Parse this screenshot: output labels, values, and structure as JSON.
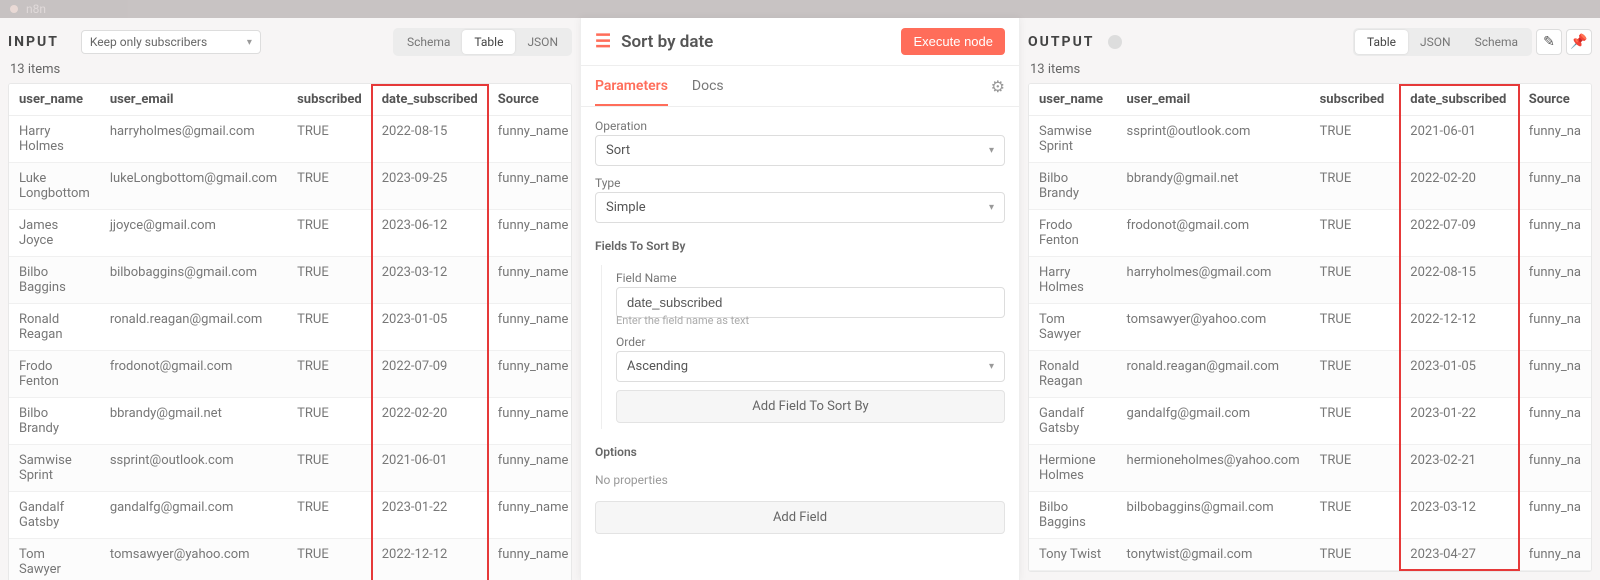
{
  "topbar": {
    "title": "n8n"
  },
  "input": {
    "title": "INPUT",
    "selector_value": "Keep only subscribers",
    "view_options": [
      "Schema",
      "Table",
      "JSON"
    ],
    "active_view": "Table",
    "count_label": "13 items",
    "columns": [
      "user_name",
      "user_email",
      "subscribed",
      "date_subscribed",
      "Source"
    ],
    "highlight_column": 3,
    "rows": [
      [
        "Harry Holmes",
        "harryholmes@gmail.com",
        "TRUE",
        "2022-08-15",
        "funny_name"
      ],
      [
        "Luke Longbottom",
        "lukeLongbottom@gmail.com",
        "TRUE",
        "2023-09-25",
        "funny_name"
      ],
      [
        "James Joyce",
        "jjoyce@gmail.com",
        "TRUE",
        "2023-06-12",
        "funny_name"
      ],
      [
        "Bilbo Baggins",
        "bilbobaggins@gmail.com",
        "TRUE",
        "2023-03-12",
        "funny_name"
      ],
      [
        "Ronald Reagan",
        "ronald.reagan@gmail.com",
        "TRUE",
        "2023-01-05",
        "funny_name"
      ],
      [
        "Frodo Fenton",
        "frodonot@gmail.com",
        "TRUE",
        "2022-07-09",
        "funny_name"
      ],
      [
        "Bilbo Brandy",
        "bbrandy@gmail.net",
        "TRUE",
        "2022-02-20",
        "funny_name"
      ],
      [
        "Samwise Sprint",
        "ssprint@outlook.com",
        "TRUE",
        "2021-06-01",
        "funny_name"
      ],
      [
        "Gandalf Gatsby",
        "gandalfg@gmail.com",
        "TRUE",
        "2023-01-22",
        "funny_name"
      ],
      [
        "Tom Sawyer",
        "tomsawyer@yahoo.com",
        "TRUE",
        "2022-12-12",
        "funny_name"
      ]
    ]
  },
  "node": {
    "title": "Sort by date",
    "execute_label": "Execute node",
    "tabs": [
      "Parameters",
      "Docs"
    ],
    "active_tab": "Parameters",
    "operation_label": "Operation",
    "operation_value": "Sort",
    "type_label": "Type",
    "type_value": "Simple",
    "fields_to_sort_label": "Fields To Sort By",
    "field_name_label": "Field Name",
    "field_name_value": "date_subscribed",
    "field_name_hint": "Enter the field name as text",
    "order_label": "Order",
    "order_value": "Ascending",
    "add_field_btn": "Add Field To Sort By",
    "options_label": "Options",
    "options_sub": "No properties",
    "add_field_btn2": "Add Field"
  },
  "output": {
    "title": "OUTPUT",
    "view_options": [
      "Table",
      "JSON",
      "Schema"
    ],
    "active_view": "Table",
    "count_label": "13 items",
    "columns": [
      "user_name",
      "user_email",
      "subscribed",
      "date_subscribed",
      "Source"
    ],
    "highlight_column": 3,
    "rows": [
      [
        "Samwise Sprint",
        "ssprint@outlook.com",
        "TRUE",
        "2021-06-01",
        "funny_na"
      ],
      [
        "Bilbo Brandy",
        "bbrandy@gmail.net",
        "TRUE",
        "2022-02-20",
        "funny_na"
      ],
      [
        "Frodo Fenton",
        "frodonot@gmail.com",
        "TRUE",
        "2022-07-09",
        "funny_na"
      ],
      [
        "Harry Holmes",
        "harryholmes@gmail.com",
        "TRUE",
        "2022-08-15",
        "funny_na"
      ],
      [
        "Tom Sawyer",
        "tomsawyer@yahoo.com",
        "TRUE",
        "2022-12-12",
        "funny_na"
      ],
      [
        "Ronald Reagan",
        "ronald.reagan@gmail.com",
        "TRUE",
        "2023-01-05",
        "funny_na"
      ],
      [
        "Gandalf Gatsby",
        "gandalfg@gmail.com",
        "TRUE",
        "2023-01-22",
        "funny_na"
      ],
      [
        "Hermione Holmes",
        "hermioneholmes@yahoo.com",
        "TRUE",
        "2023-02-21",
        "funny_na"
      ],
      [
        "Bilbo Baggins",
        "bilbobaggins@gmail.com",
        "TRUE",
        "2023-03-12",
        "funny_na"
      ],
      [
        "Tony Twist",
        "tonytwist@gmail.com",
        "TRUE",
        "2023-04-27",
        "funny_na"
      ]
    ]
  }
}
